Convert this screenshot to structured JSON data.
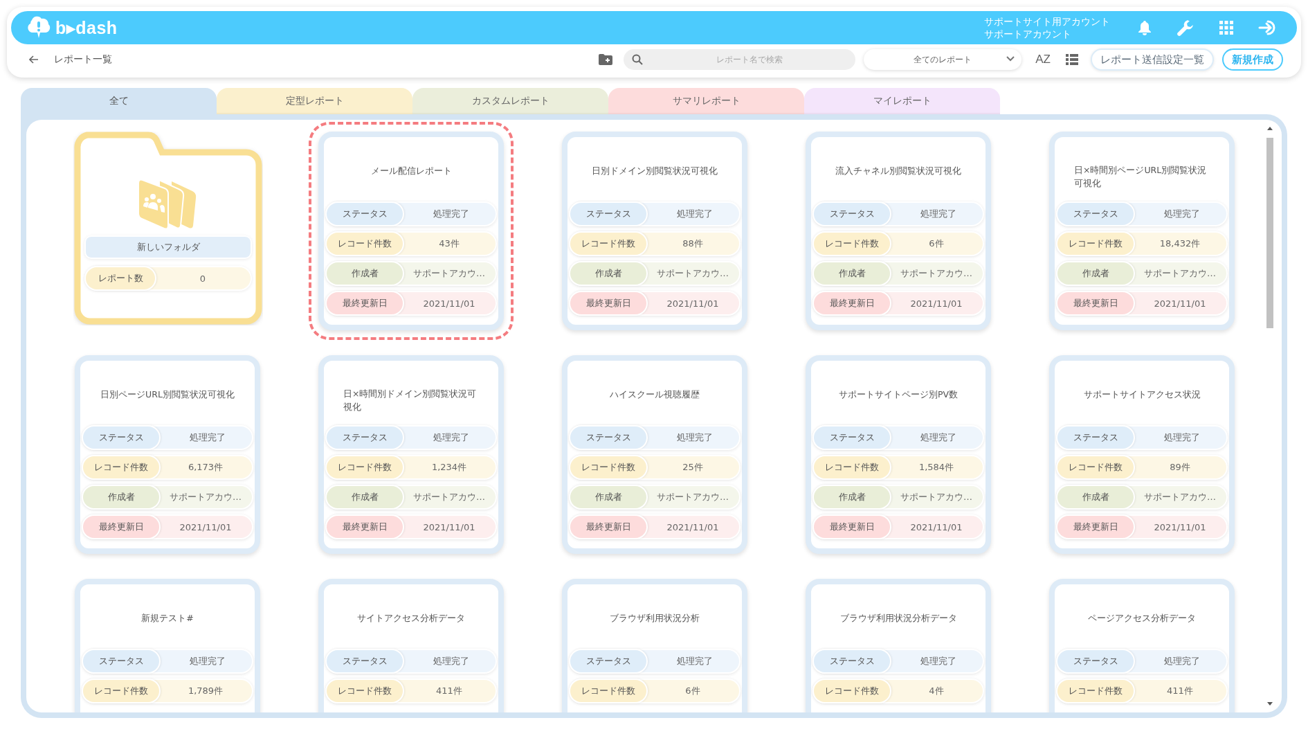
{
  "header": {
    "logo": "b▸dash",
    "account_site": "サポートサイト用アカウント",
    "account_name": "サポートアカウント"
  },
  "toolbar": {
    "title": "レポート一覧",
    "search": {
      "placeholder": "レポート名で検索"
    },
    "filter": {
      "value": "全てのレポート"
    },
    "sort": "AZ",
    "buttons": [
      {
        "kind": "outline",
        "label": "レポート送信設定一覧"
      },
      {
        "kind": "primary",
        "label": "新規作成"
      }
    ]
  },
  "tabs": [
    {
      "label": "全て",
      "selected": true,
      "color": "#d3e4f3"
    },
    {
      "label": "定型レポート",
      "selected": false,
      "color": "#fbf0cd"
    },
    {
      "label": "カスタムレポート",
      "selected": false,
      "color": "#ebeedb"
    },
    {
      "label": "サマリレポート",
      "selected": false,
      "color": "#fddcdc"
    },
    {
      "label": "マイレポート",
      "selected": false,
      "color": "#f4e5fb"
    }
  ],
  "items": [
    {
      "kind": "folder",
      "name": "新しいフォルダ",
      "count_label": "レポート数",
      "count": "0"
    },
    {
      "kind": "report",
      "title": "メール配信レポート",
      "selected": true,
      "fields": [
        {
          "kind": "status",
          "label": "ステータス",
          "value": "処理完了"
        },
        {
          "kind": "records",
          "label": "レコード件数",
          "value": "43件"
        },
        {
          "kind": "author",
          "label": "作成者",
          "value": "サポートアカウ…"
        },
        {
          "kind": "date",
          "label": "最終更新日",
          "value": "2021/11/01"
        }
      ]
    },
    {
      "kind": "report",
      "title": "日別ドメイン別閲覧状況可視化",
      "selected": false,
      "fields": [
        {
          "kind": "status",
          "label": "ステータス",
          "value": "処理完了"
        },
        {
          "kind": "records",
          "label": "レコード件数",
          "value": "88件"
        },
        {
          "kind": "author",
          "label": "作成者",
          "value": "サポートアカウ…"
        },
        {
          "kind": "date",
          "label": "最終更新日",
          "value": "2021/11/01"
        }
      ]
    },
    {
      "kind": "report",
      "title": "流入チャネル別閲覧状況可視化",
      "selected": false,
      "fields": [
        {
          "kind": "status",
          "label": "ステータス",
          "value": "処理完了"
        },
        {
          "kind": "records",
          "label": "レコード件数",
          "value": "6件"
        },
        {
          "kind": "author",
          "label": "作成者",
          "value": "サポートアカウ…"
        },
        {
          "kind": "date",
          "label": "最終更新日",
          "value": "2021/11/01"
        }
      ]
    },
    {
      "kind": "report",
      "title": "日×時間別ページURL別閲覧状況可視化",
      "selected": false,
      "fields": [
        {
          "kind": "status",
          "label": "ステータス",
          "value": "処理完了"
        },
        {
          "kind": "records",
          "label": "レコード件数",
          "value": "18,432件"
        },
        {
          "kind": "author",
          "label": "作成者",
          "value": "サポートアカウ…"
        },
        {
          "kind": "date",
          "label": "最終更新日",
          "value": "2021/11/01"
        }
      ]
    },
    {
      "kind": "report",
      "title": "日別ページURL別閲覧状況可視化",
      "selected": false,
      "fields": [
        {
          "kind": "status",
          "label": "ステータス",
          "value": "処理完了"
        },
        {
          "kind": "records",
          "label": "レコード件数",
          "value": "6,173件"
        },
        {
          "kind": "author",
          "label": "作成者",
          "value": "サポートアカウ…"
        },
        {
          "kind": "date",
          "label": "最終更新日",
          "value": "2021/11/01"
        }
      ]
    },
    {
      "kind": "report",
      "title": "日×時間別ドメイン別閲覧状況可視化",
      "selected": false,
      "fields": [
        {
          "kind": "status",
          "label": "ステータス",
          "value": "処理完了"
        },
        {
          "kind": "records",
          "label": "レコード件数",
          "value": "1,234件"
        },
        {
          "kind": "author",
          "label": "作成者",
          "value": "サポートアカウ…"
        },
        {
          "kind": "date",
          "label": "最終更新日",
          "value": "2021/11/01"
        }
      ]
    },
    {
      "kind": "report",
      "title": "ハイスクール視聴履歴",
      "selected": false,
      "fields": [
        {
          "kind": "status",
          "label": "ステータス",
          "value": "処理完了"
        },
        {
          "kind": "records",
          "label": "レコード件数",
          "value": "25件"
        },
        {
          "kind": "author",
          "label": "作成者",
          "value": "サポートアカウ…"
        },
        {
          "kind": "date",
          "label": "最終更新日",
          "value": "2021/11/01"
        }
      ]
    },
    {
      "kind": "report",
      "title": "サポートサイトページ別PV数",
      "selected": false,
      "fields": [
        {
          "kind": "status",
          "label": "ステータス",
          "value": "処理完了"
        },
        {
          "kind": "records",
          "label": "レコード件数",
          "value": "1,584件"
        },
        {
          "kind": "author",
          "label": "作成者",
          "value": "サポートアカウ…"
        },
        {
          "kind": "date",
          "label": "最終更新日",
          "value": "2021/11/01"
        }
      ]
    },
    {
      "kind": "report",
      "title": "サポートサイトアクセス状況",
      "selected": false,
      "fields": [
        {
          "kind": "status",
          "label": "ステータス",
          "value": "処理完了"
        },
        {
          "kind": "records",
          "label": "レコード件数",
          "value": "89件"
        },
        {
          "kind": "author",
          "label": "作成者",
          "value": "サポートアカウ…"
        },
        {
          "kind": "date",
          "label": "最終更新日",
          "value": "2021/11/01"
        }
      ]
    },
    {
      "kind": "report",
      "title": "新規テスト#",
      "selected": false,
      "fields": [
        {
          "kind": "status",
          "label": "ステータス",
          "value": "処理完了"
        },
        {
          "kind": "records",
          "label": "レコード件数",
          "value": "1,789件"
        }
      ]
    },
    {
      "kind": "report",
      "title": "サイトアクセス分析データ",
      "selected": false,
      "fields": [
        {
          "kind": "status",
          "label": "ステータス",
          "value": "処理完了"
        },
        {
          "kind": "records",
          "label": "レコード件数",
          "value": "411件"
        }
      ]
    },
    {
      "kind": "report",
      "title": "ブラウザ利用状況分析",
      "selected": false,
      "fields": [
        {
          "kind": "status",
          "label": "ステータス",
          "value": "処理完了"
        },
        {
          "kind": "records",
          "label": "レコード件数",
          "value": "6件"
        }
      ]
    },
    {
      "kind": "report",
      "title": "ブラウザ利用状況分析データ",
      "selected": false,
      "fields": [
        {
          "kind": "status",
          "label": "ステータス",
          "value": "処理完了"
        },
        {
          "kind": "records",
          "label": "レコード件数",
          "value": "4件"
        }
      ]
    },
    {
      "kind": "report",
      "title": "ページアクセス分析データ",
      "selected": false,
      "fields": [
        {
          "kind": "status",
          "label": "ステータス",
          "value": "処理完了"
        },
        {
          "kind": "records",
          "label": "レコード件数",
          "value": "411件"
        }
      ]
    }
  ]
}
